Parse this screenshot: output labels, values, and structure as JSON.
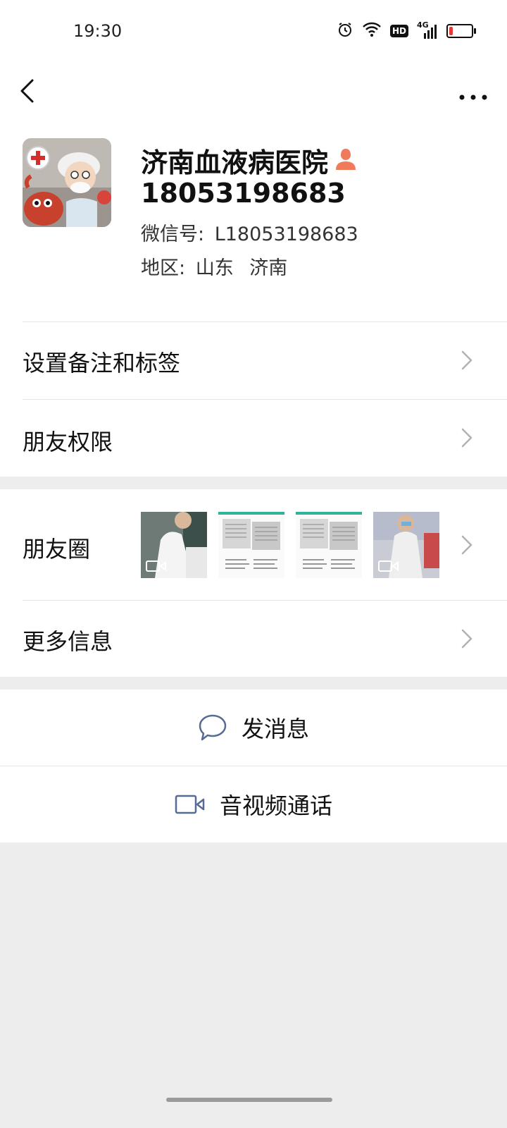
{
  "status_bar": {
    "time": "19:30",
    "icons": [
      "alarm-icon",
      "wifi-icon",
      "hd-badge",
      "signal-4g-icon",
      "battery-low-icon"
    ],
    "hd_label": "HD",
    "network_label": "4G",
    "battery_level": 0.15,
    "battery_color": "#e53935"
  },
  "nav": {
    "back_icon": "chevron-left-icon",
    "more_icon": "more-dots-icon"
  },
  "profile": {
    "name": "济南血液病医院",
    "gender_icon": "female-icon",
    "gender_icon_color": "#f07b5a",
    "number": "18053198683",
    "wechat_id_label": "微信号:",
    "wechat_id": "L18053198683",
    "region_label": "地区:",
    "region_province": "山东",
    "region_city": "济南"
  },
  "menu": {
    "remark_label": "设置备注和标签",
    "permissions_label": "朋友权限",
    "moments_label": "朋友圈",
    "more_info_label": "更多信息"
  },
  "moments": {
    "thumbnails": [
      {
        "kind": "video",
        "description_icon": "video-icon"
      },
      {
        "kind": "image"
      },
      {
        "kind": "image"
      },
      {
        "kind": "video",
        "description_icon": "video-icon"
      }
    ]
  },
  "actions": {
    "message_label": "发消息",
    "message_icon": "chat-bubble-icon",
    "call_label": "音视频通话",
    "call_icon": "video-camera-icon",
    "icon_color": "#576b95"
  },
  "colors": {
    "background": "#ededed",
    "card": "#ffffff",
    "chevron": "#b2b2b2"
  }
}
